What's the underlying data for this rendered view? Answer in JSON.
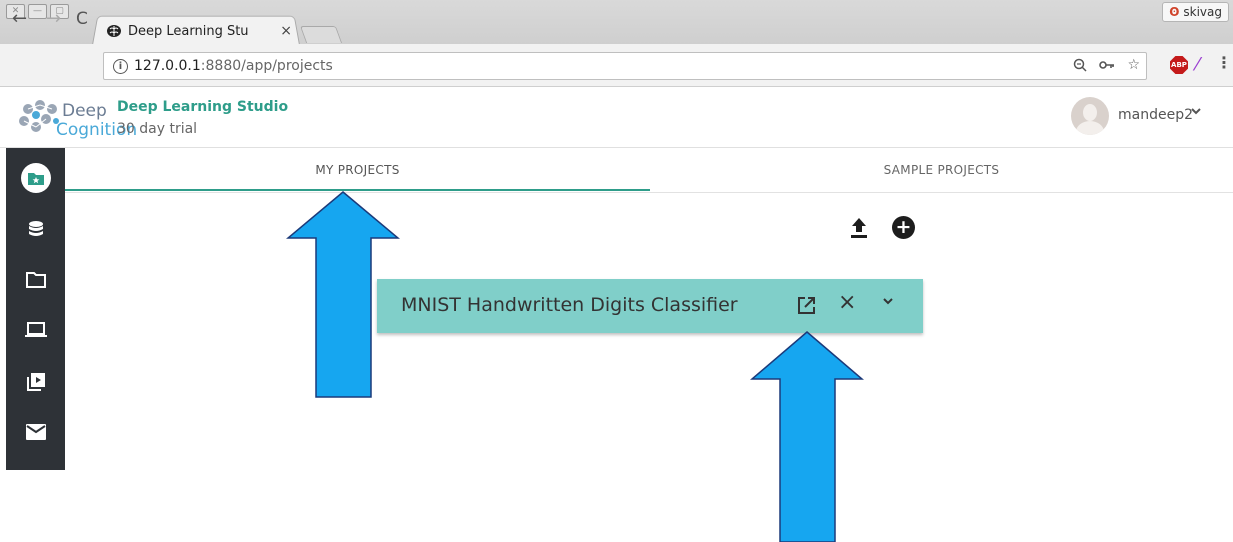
{
  "browser": {
    "window_controls": [
      "✕",
      "—",
      "▢"
    ],
    "tab_title": "Deep Learning Stu",
    "tab_close": "×",
    "profile_name": "skivag",
    "url_host": "127.0.0.1",
    "url_path": ":8880/app/projects",
    "adblock_label": "ABP"
  },
  "app": {
    "logo_word_1": "Deep",
    "logo_word_2": "Cognition",
    "product_name": "Deep Learning Studio",
    "trial_label": "30 day trial",
    "username": "mandeep2"
  },
  "sidebar": {
    "items": [
      {
        "icon": "folder-star-icon",
        "active": true
      },
      {
        "icon": "database-icon",
        "active": false
      },
      {
        "icon": "folder-icon",
        "active": false
      },
      {
        "icon": "laptop-icon",
        "active": false
      },
      {
        "icon": "video-library-icon",
        "active": false
      },
      {
        "icon": "mail-icon",
        "active": false
      }
    ],
    "accent_color": "#2e9d8a"
  },
  "tabs": {
    "my_projects": "MY PROJECTS",
    "sample_projects": "SAMPLE PROJECTS",
    "active": "my_projects"
  },
  "project": {
    "name": "MNIST Handwritten Digits Classifier",
    "card_color": "#80cfc9"
  },
  "annotation": {
    "arrow_color": "#16a6f0",
    "arrow_count": 2
  }
}
